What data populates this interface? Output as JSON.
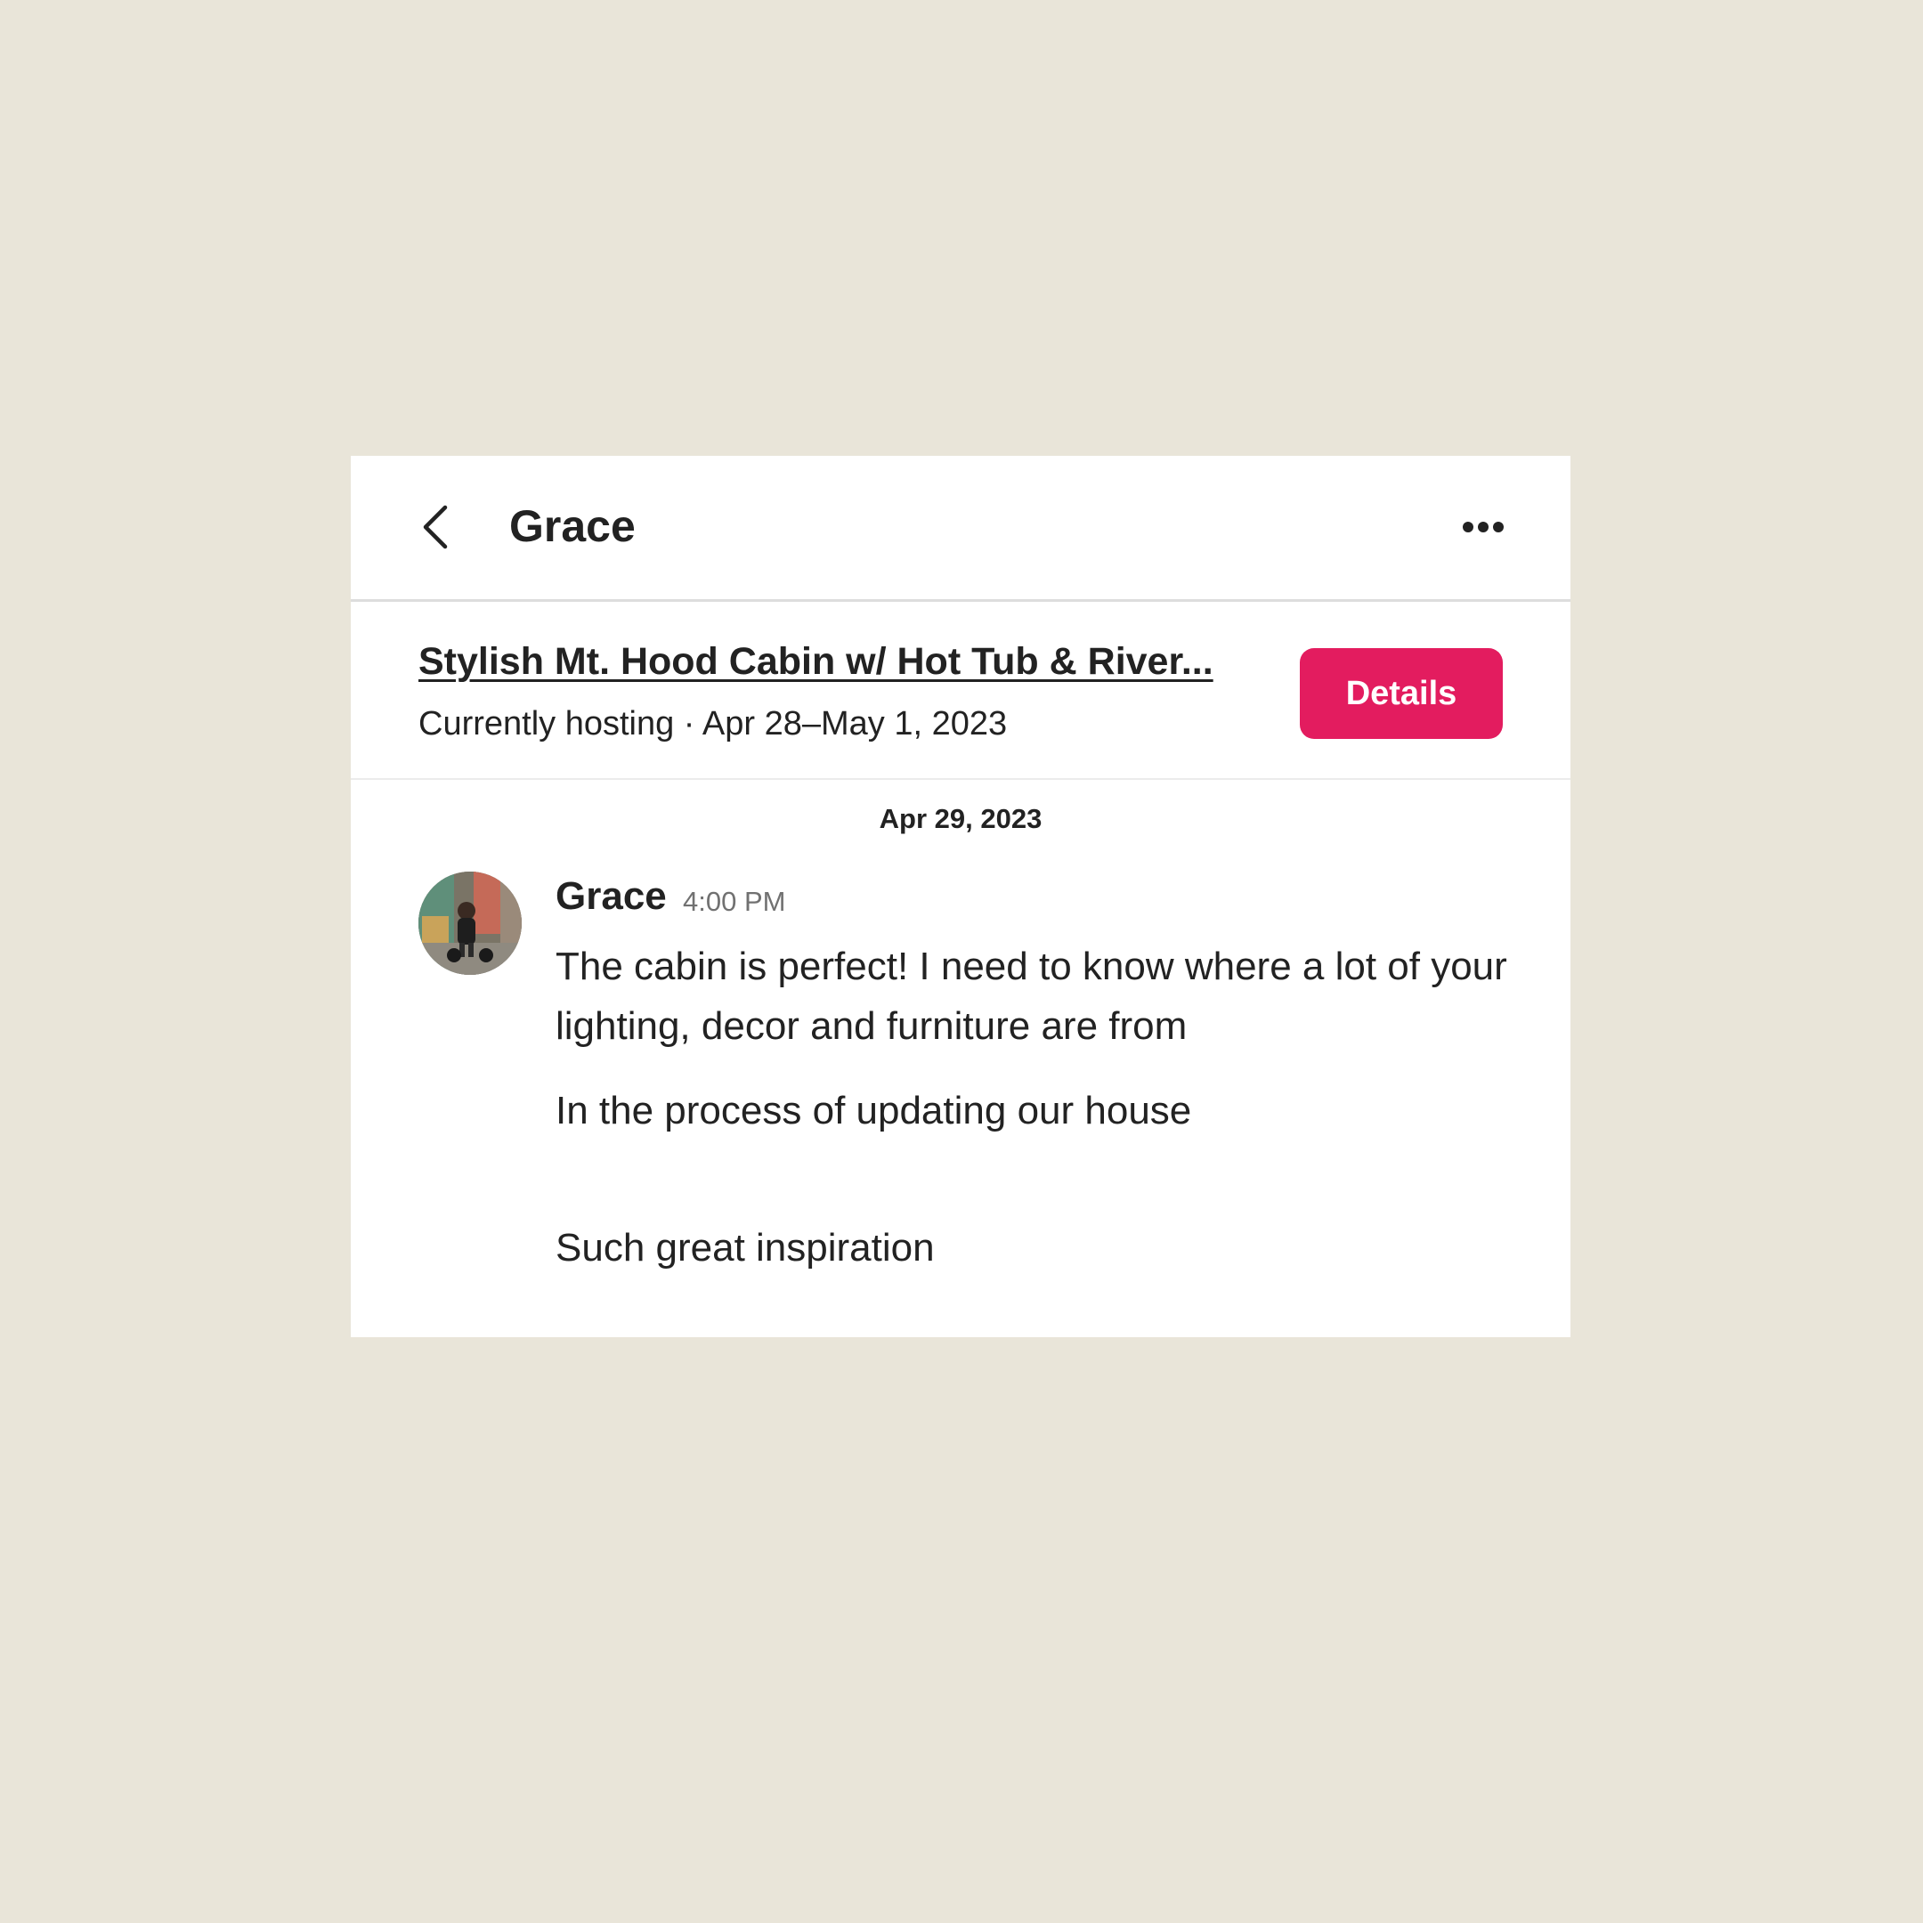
{
  "header": {
    "title": "Grace",
    "back_icon": "chevron-left-icon",
    "more_icon": "more-horizontal-icon"
  },
  "listing": {
    "title": "Stylish Mt. Hood Cabin w/ Hot Tub & River...",
    "subtitle": "Currently hosting · Apr 28–May 1, 2023",
    "details_label": "Details",
    "accent_color": "#e31c5f"
  },
  "thread": {
    "date": "Apr 29, 2023",
    "message": {
      "sender": "Grace",
      "time": "4:00 PM",
      "lines": [
        "The cabin is perfect! I need to know where a lot of your lighting, decor and furniture are from",
        "In the process of updating our house",
        "Such great inspiration"
      ]
    }
  }
}
